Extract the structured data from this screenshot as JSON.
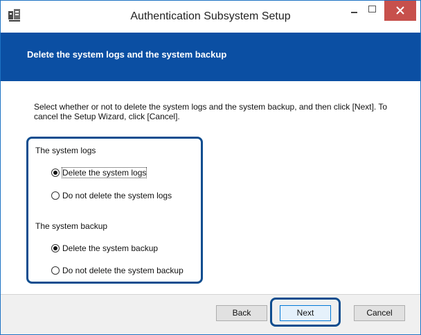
{
  "window": {
    "title": "Authentication Subsystem Setup",
    "accent": "#0b4fa3",
    "close_color": "#c7504c"
  },
  "titlebar_icons": {
    "app": "setup-app-icon",
    "minimize": "minimize-icon",
    "maximize": "maximize-icon",
    "close": "close-icon"
  },
  "banner": {
    "title": "Delete the system logs and the system backup"
  },
  "content": {
    "instruction": "Select whether or not to delete the system logs and the system backup, and then click [Next]. To cancel the Setup Wizard, click [Cancel].",
    "groups": [
      {
        "label": "The system logs",
        "options": [
          {
            "label": "Delete the system logs",
            "selected": true
          },
          {
            "label": "Do not delete the system logs",
            "selected": false
          }
        ]
      },
      {
        "label": "The system backup",
        "options": [
          {
            "label": "Delete the system backup",
            "selected": true
          },
          {
            "label": "Do not delete the system backup",
            "selected": false
          }
        ]
      }
    ]
  },
  "footer": {
    "back_label": "Back",
    "next_label": "Next",
    "cancel_label": "Cancel"
  }
}
